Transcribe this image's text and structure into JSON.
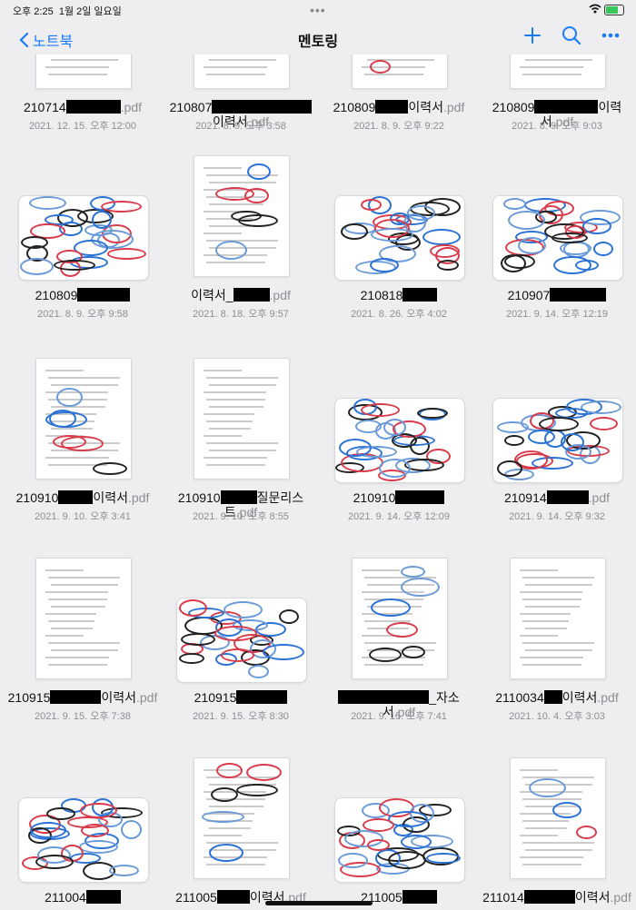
{
  "status": {
    "time": "오후 2:25",
    "date": "1월 2일 일요일",
    "battery_level": 0.7
  },
  "nav": {
    "back_label": "노트북",
    "title": "멘토링"
  },
  "icons": [
    "chevron-left-icon",
    "plus-icon",
    "search-icon",
    "more-icon",
    "wifi-icon",
    "battery-icon"
  ],
  "items": [
    {
      "n1": "210714",
      "n2": "",
      "ext": ".pdf",
      "date": "2021. 12. 15. 오후 12:00"
    },
    {
      "n1": "210807",
      "n2": "이력서",
      "ext": ".pdf",
      "date": "2021. 8. 9. 오후 3:58"
    },
    {
      "n1": "210809",
      "n2": "이력서",
      "ext": ".pdf",
      "date": "2021. 8. 9. 오후 9:22"
    },
    {
      "n1": "210809",
      "n2": "이력서",
      "ext": ".pdf",
      "date": "2021. 8. 9. 오후 9:03"
    },
    {
      "n1": "210809",
      "n2": "",
      "ext": "",
      "date": "2021. 8. 9. 오후 9:58"
    },
    {
      "n1": "이력서_",
      "n2": "",
      "ext": ".pdf",
      "date": "2021. 8. 18. 오후 9:57"
    },
    {
      "n1": "210818",
      "n2": "",
      "ext": "",
      "date": "2021. 8. 26. 오후 4:02"
    },
    {
      "n1": "210907",
      "n2": "",
      "ext": "",
      "date": "2021. 9. 14. 오후 12:19"
    },
    {
      "n1": "210910",
      "n2": "이력서",
      "ext": ".pdf",
      "date": "2021. 9. 10. 오후 3:41"
    },
    {
      "n1": "210910",
      "n2": "질문리스트",
      "ext": ".pdf",
      "date": "2021. 9. 10. 오후 8:55"
    },
    {
      "n1": "210910",
      "n2": "",
      "ext": "",
      "date": "2021. 9. 14. 오후 12:09"
    },
    {
      "n1": "210914",
      "n2": "",
      "ext": ".pdf",
      "date": "2021. 9. 14. 오후 9:32"
    },
    {
      "n1": "210915",
      "n2": "이력서",
      "ext": ".pdf",
      "date": "2021. 9. 15. 오후 7:38"
    },
    {
      "n1": "210915",
      "n2": "",
      "ext": "",
      "date": "2021. 9. 15. 오후 8:30"
    },
    {
      "n1": "",
      "n2": "_자소서",
      "ext": ".pdf",
      "date": "2021. 9. 15. 오후 7:41"
    },
    {
      "n1": "2110034",
      "n2": "이력서",
      "ext": ".pdf",
      "date": "2021. 10. 4. 오후 3:03"
    },
    {
      "n1": "211004",
      "n2": "",
      "ext": "",
      "date": ""
    },
    {
      "n1": "211005",
      "n2": "이력서",
      "ext": ".pdf",
      "date": ""
    },
    {
      "n1": "211005",
      "n2": "",
      "ext": "",
      "date": ""
    },
    {
      "n1": "211014",
      "n2": "이력서",
      "ext": ".pdf",
      "date": ""
    }
  ]
}
